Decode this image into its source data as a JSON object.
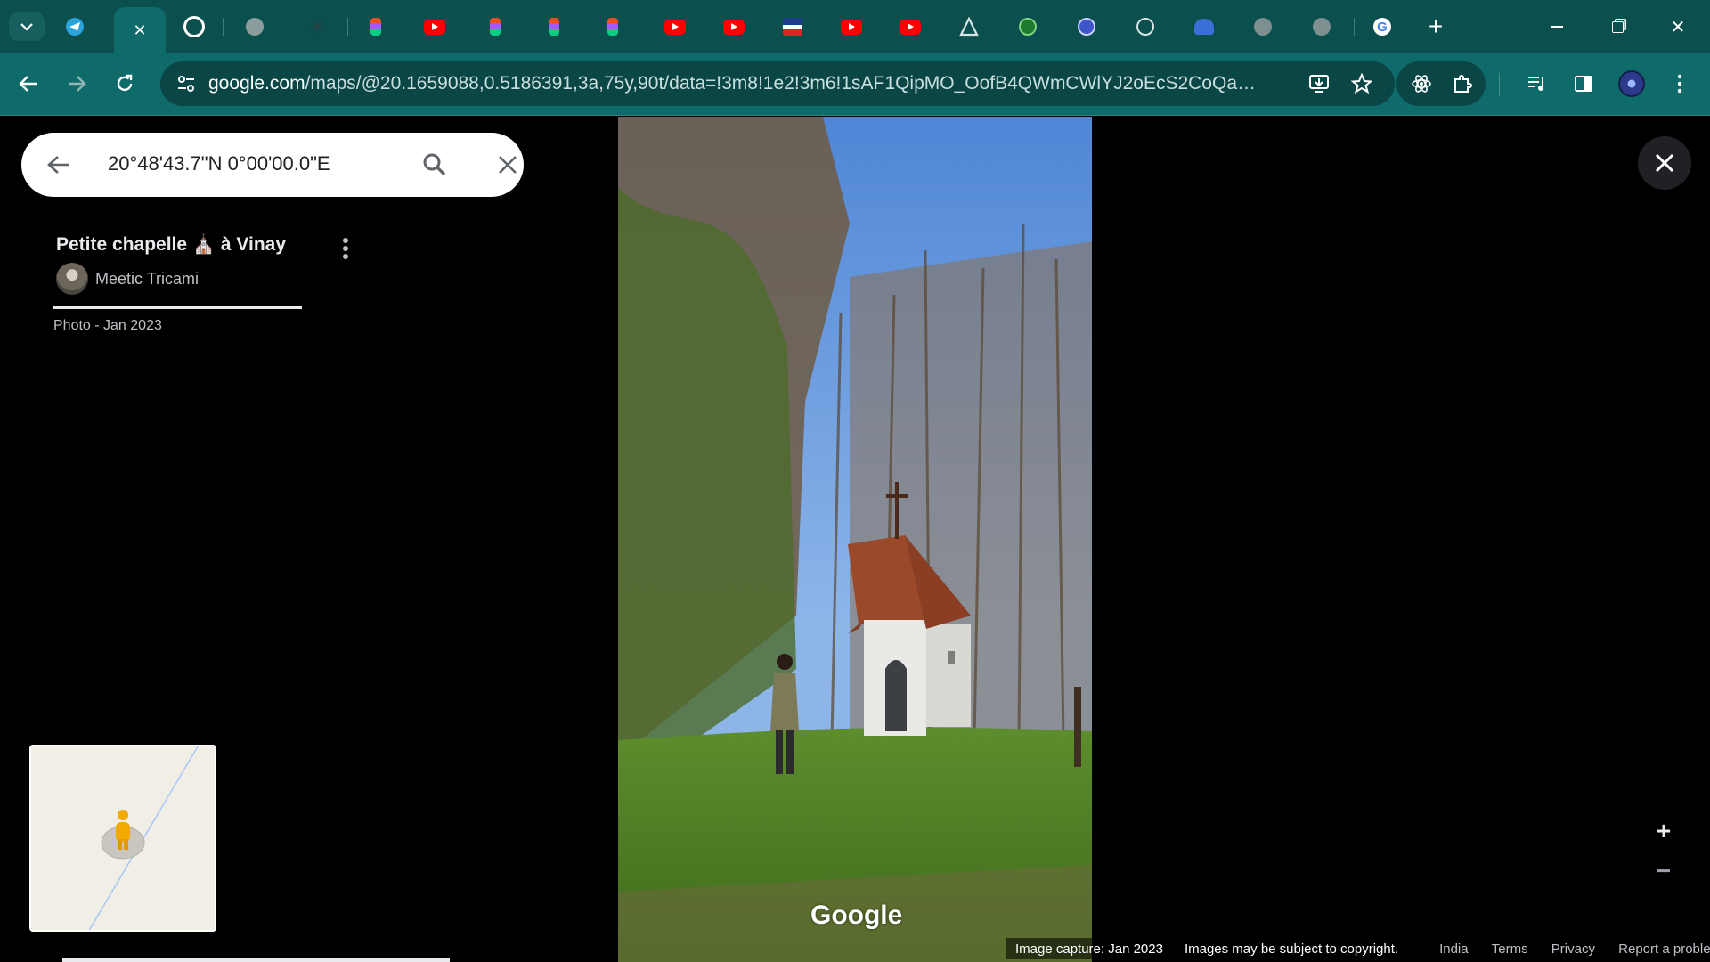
{
  "browser": {
    "active_tab_close": "✕",
    "new_tab": "+",
    "url_domain": "google.com",
    "url_path": "/maps/@20.1659088,0.5186391,3a,75y,90t/data=!3m8!1e2!3m6!1sAF1QipMO_OofB4QWmCWlYJ2oEcS2CoQaVr3QtR...",
    "accent": "#0f6a6a"
  },
  "search": {
    "query": "20°48'43.7\"N 0°00'00.0\"E"
  },
  "photo_info": {
    "title": "Petite chapelle ⛪ à Vinay",
    "author": "Meetic Tricami",
    "date": "Photo - Jan 2023"
  },
  "viewer": {
    "watermark": "Google",
    "zoom_in": "+",
    "zoom_out": "−"
  },
  "footer": {
    "capture": "Image capture: Jan 2023",
    "copyright": "Images may be subject to copyright.",
    "links": [
      "India",
      "Terms",
      "Privacy",
      "Report a problem"
    ]
  }
}
